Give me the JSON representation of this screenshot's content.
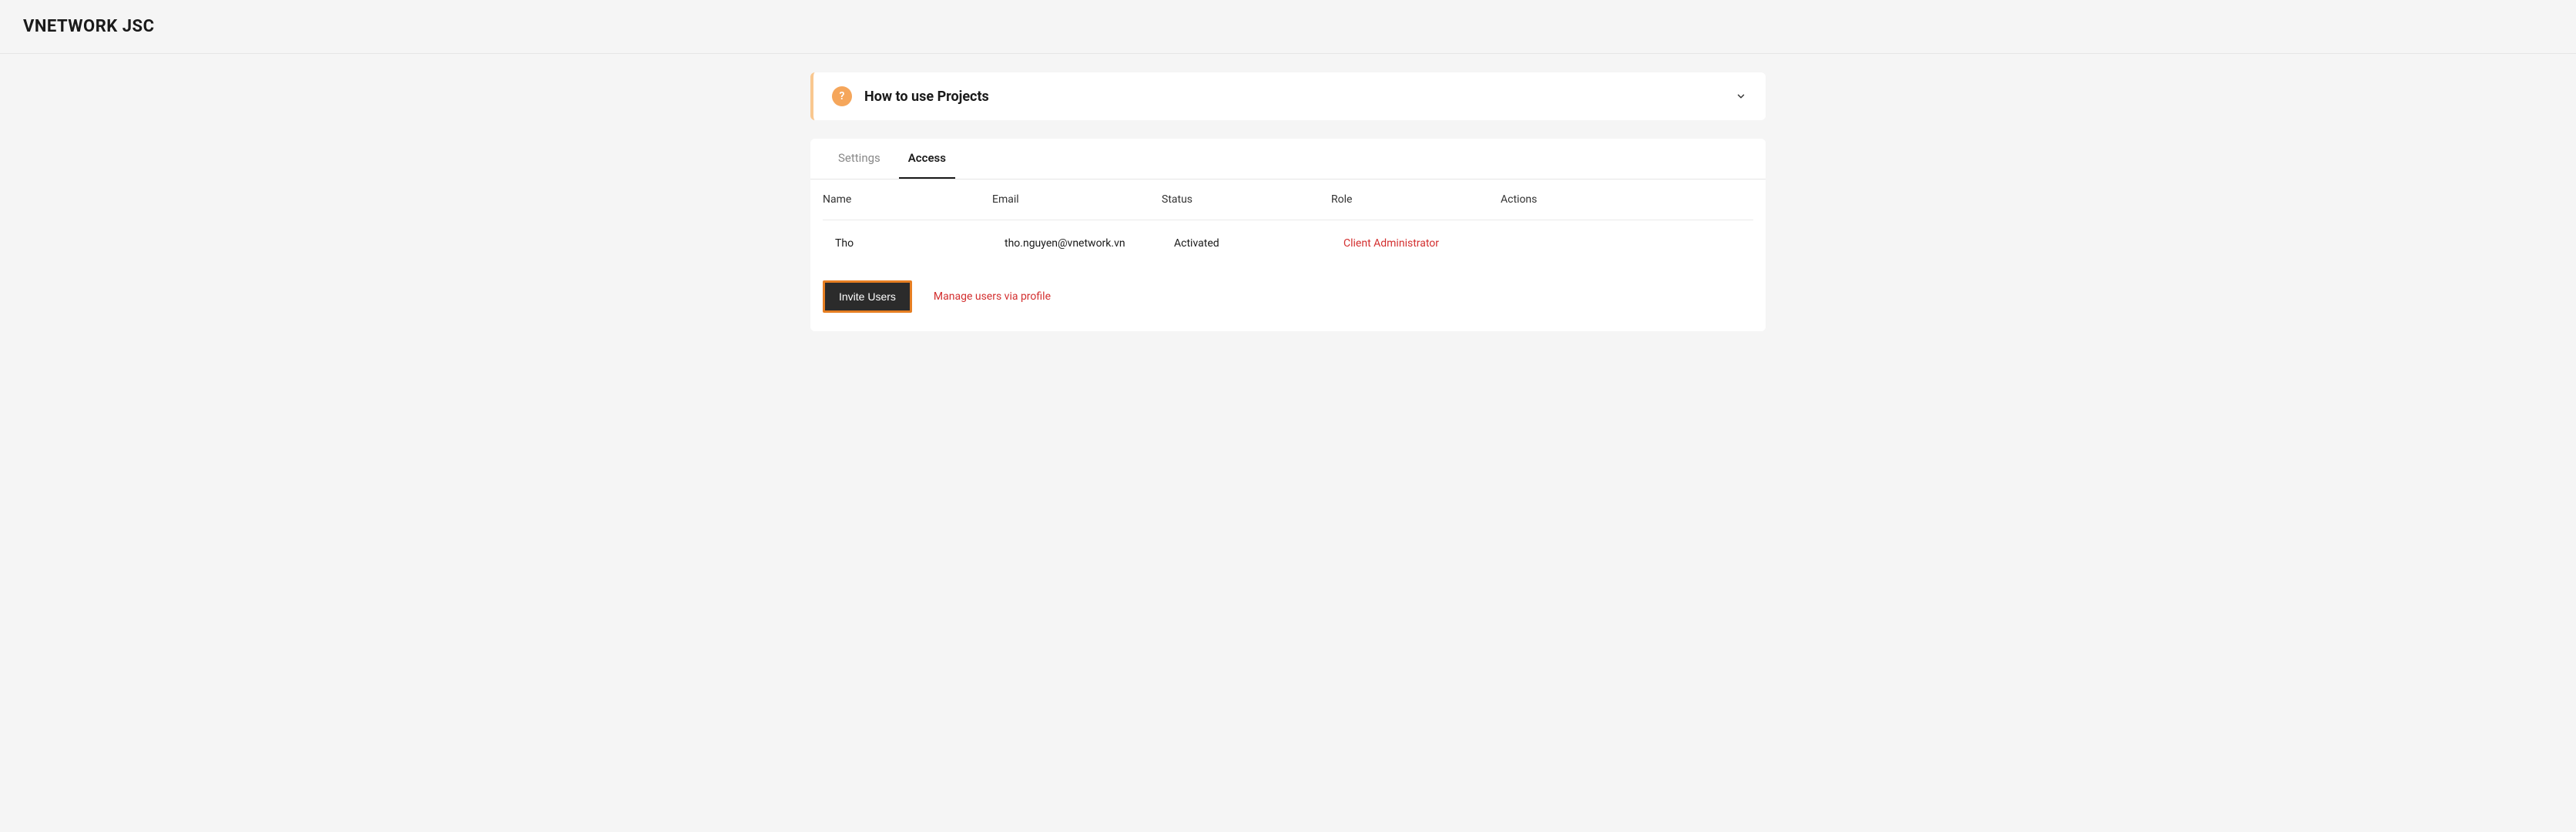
{
  "header": {
    "title": "VNETWORK JSC"
  },
  "help_banner": {
    "title": "How to use Projects",
    "icon_char": "?"
  },
  "tabs": [
    {
      "label": "Settings",
      "active": false
    },
    {
      "label": "Access",
      "active": true
    }
  ],
  "table": {
    "headers": {
      "name": "Name",
      "email": "Email",
      "status": "Status",
      "role": "Role",
      "actions": "Actions"
    },
    "rows": [
      {
        "name": "Tho",
        "email": "tho.nguyen@vnetwork.vn",
        "status": "Activated",
        "role": "Client Administrator"
      }
    ]
  },
  "actions": {
    "invite_label": "Invite Users",
    "manage_label": "Manage users via profile"
  },
  "colors": {
    "accent_orange": "#e67e22",
    "danger_red": "#d32f2f",
    "help_icon_bg": "#f5a65b"
  }
}
